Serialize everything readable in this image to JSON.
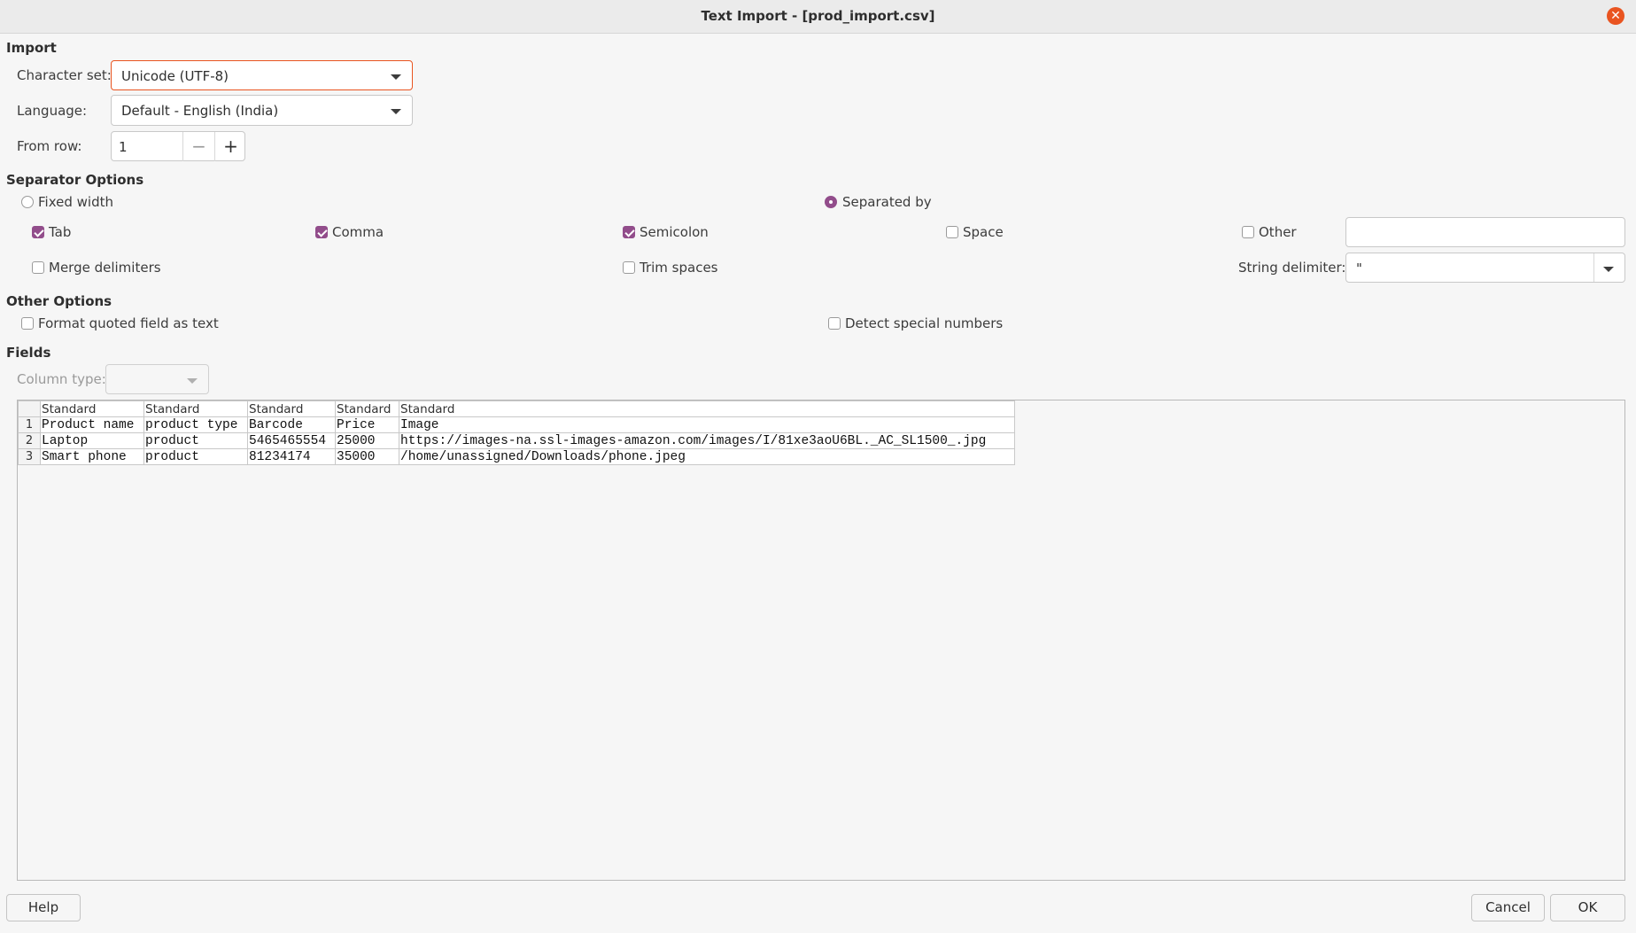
{
  "window": {
    "title": "Text Import - [prod_import.csv]"
  },
  "import": {
    "section_label": "Import",
    "charset_label": "Character set:",
    "charset_value": "Unicode (UTF-8)",
    "language_label": "Language:",
    "language_value": "Default - English (India)",
    "from_row_label": "From row:",
    "from_row_value": "1",
    "minus": "−",
    "plus": "+"
  },
  "separator": {
    "section_label": "Separator Options",
    "fixed_width_label": "Fixed width",
    "separated_by_label": "Separated by",
    "tab_label": "Tab",
    "comma_label": "Comma",
    "semicolon_label": "Semicolon",
    "space_label": "Space",
    "other_label": "Other",
    "other_value": "",
    "merge_label": "Merge delimiters",
    "trim_label": "Trim spaces",
    "string_delim_label": "String delimiter:",
    "string_delim_value": "\"",
    "states": {
      "fixed_width": false,
      "separated_by": true,
      "tab": true,
      "comma": true,
      "semicolon": true,
      "space": false,
      "other": false,
      "merge": false,
      "trim": false
    }
  },
  "other_options": {
    "section_label": "Other Options",
    "format_quoted_label": "Format quoted field as text",
    "detect_special_label": "Detect special numbers"
  },
  "fields": {
    "section_label": "Fields",
    "column_type_label": "Column type:",
    "headers": [
      "Standard",
      "Standard",
      "Standard",
      "Standard",
      "Standard"
    ],
    "rows": [
      {
        "num": "1",
        "cells": [
          "Product name",
          "product type",
          "Barcode",
          "Price",
          "Image"
        ]
      },
      {
        "num": "2",
        "cells": [
          "Laptop",
          "product",
          "5465465554",
          "25000",
          "https://images-na.ssl-images-amazon.com/images/I/81xe3aoU6BL._AC_SL1500_.jpg"
        ]
      },
      {
        "num": "3",
        "cells": [
          "Smart phone",
          "product",
          "81234174",
          "35000",
          "/home/unassigned/Downloads/phone.jpeg"
        ]
      }
    ]
  },
  "buttons": {
    "help": "Help",
    "cancel": "Cancel",
    "ok": "OK"
  },
  "colors": {
    "accent": "#924d8b",
    "focus": "#e95420"
  }
}
